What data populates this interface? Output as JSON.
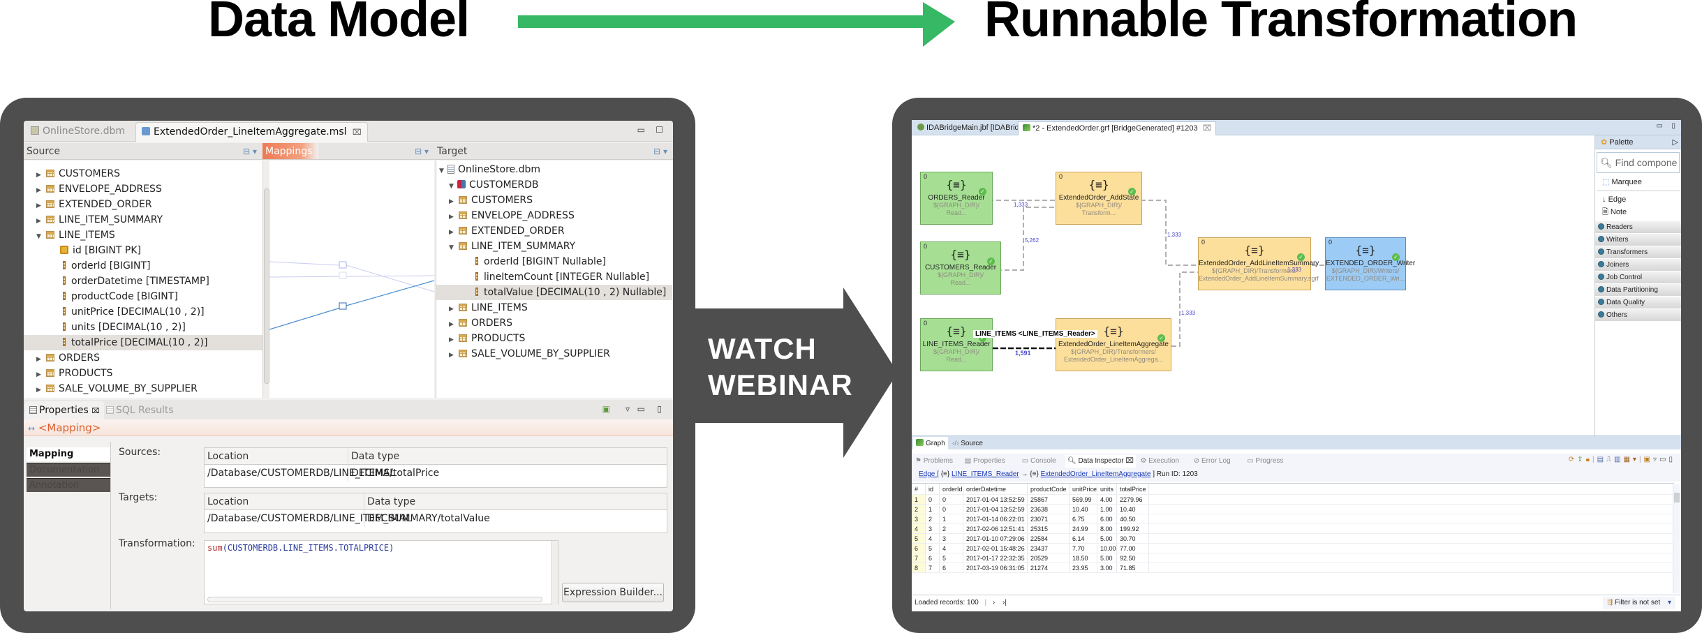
{
  "headline": {
    "left": "Data Model",
    "right": "Runnable Transformation",
    "arrow_color": "#36b864"
  },
  "cta": {
    "line1": "WATCH",
    "line2": "WEBINAR",
    "color": "#4e4e4e"
  },
  "data_model": {
    "tabs": [
      {
        "label": "OnlineStore.dbm",
        "active": false
      },
      {
        "label": "ExtendedOrder_LineItemAggregate.msl",
        "active": true,
        "close": "⌧"
      }
    ],
    "source_header": "Source",
    "mappings_header": "Mappings",
    "target_header": "Target",
    "source_tree": [
      {
        "label": "CUSTOMERS",
        "kind": "table",
        "expanded": false
      },
      {
        "label": "ENVELOPE_ADDRESS",
        "kind": "table",
        "expanded": false
      },
      {
        "label": "EXTENDED_ORDER",
        "kind": "table",
        "expanded": false
      },
      {
        "label": "LINE_ITEM_SUMMARY",
        "kind": "table",
        "expanded": false
      },
      {
        "label": "LINE_ITEMS",
        "kind": "table",
        "expanded": true
      },
      {
        "label": "id [BIGINT PK]",
        "kind": "pk"
      },
      {
        "label": "orderId [BIGINT]",
        "kind": "column"
      },
      {
        "label": "orderDatetime [TIMESTAMP]",
        "kind": "column"
      },
      {
        "label": "productCode [BIGINT]",
        "kind": "column"
      },
      {
        "label": "unitPrice [DECIMAL(10 , 2)]",
        "kind": "column"
      },
      {
        "label": "units [DECIMAL(10 , 2)]",
        "kind": "column"
      },
      {
        "label": "totalPrice [DECIMAL(10 , 2)]",
        "kind": "column",
        "selected": true
      },
      {
        "label": "ORDERS",
        "kind": "table",
        "expanded": false
      },
      {
        "label": "PRODUCTS",
        "kind": "table",
        "expanded": false
      },
      {
        "label": "SALE_VOLUME_BY_SUPPLIER",
        "kind": "table",
        "expanded": false
      }
    ],
    "target_tree": [
      {
        "label": "OnlineStore.dbm",
        "kind": "file",
        "expanded": true
      },
      {
        "label": "CUSTOMERDB",
        "kind": "db",
        "expanded": true
      },
      {
        "label": "CUSTOMERS",
        "kind": "table",
        "expanded": false
      },
      {
        "label": "ENVELOPE_ADDRESS",
        "kind": "table",
        "expanded": false
      },
      {
        "label": "EXTENDED_ORDER",
        "kind": "table",
        "expanded": false
      },
      {
        "label": "LINE_ITEM_SUMMARY",
        "kind": "table",
        "expanded": true
      },
      {
        "label": "orderId [BIGINT Nullable]",
        "kind": "column"
      },
      {
        "label": "lineItemCount [INTEGER Nullable]",
        "kind": "column"
      },
      {
        "label": "totalValue [DECIMAL(10 , 2) Nullable]",
        "kind": "column",
        "selected": true
      },
      {
        "label": "LINE_ITEMS",
        "kind": "table",
        "expanded": false
      },
      {
        "label": "ORDERS",
        "kind": "table",
        "expanded": false
      },
      {
        "label": "PRODUCTS",
        "kind": "table",
        "expanded": false
      },
      {
        "label": "SALE_VOLUME_BY_SUPPLIER",
        "kind": "table",
        "expanded": false
      }
    ],
    "properties": {
      "tabs": [
        {
          "label": "Properties",
          "active": true
        },
        {
          "label": "SQL Results",
          "active": false
        }
      ],
      "title": "<Mapping>",
      "side_tabs": [
        "Mapping",
        "Documentation",
        "Annotation"
      ],
      "sources_label": "Sources:",
      "targets_label": "Targets:",
      "transformation_label": "Transformation:",
      "col_location": "Location",
      "col_datatype": "Data type",
      "sources": [
        {
          "location": "/Database/CUSTOMERDB/LINE_ITEMS/totalPrice",
          "type": "DECIMAL"
        }
      ],
      "targets": [
        {
          "location": "/Database/CUSTOMERDB/LINE_ITEM_SUMMARY/totalValue",
          "type": "DECIMAL"
        }
      ],
      "transformation_fn": "sum",
      "transformation_arg": "(CUSTOMERDB.LINE_ITEMS.TOTALPRICE)",
      "expression_builder": "Expression Builder..."
    }
  },
  "transformation": {
    "tabs": [
      {
        "label": "IDABridgeMain.jbf [IDABridge]",
        "active": false
      },
      {
        "label": "*2 - ExtendedOrder.grf [BridgeGenerated] #1203",
        "active": true
      }
    ],
    "nodes": [
      {
        "id": "orders_reader",
        "name": "ORDERS_Reader",
        "sub1": "${GRAPH_DIR}/",
        "sub2": "Read...",
        "color": "green",
        "count": "0"
      },
      {
        "id": "customers_reader",
        "name": "CUSTOMERS_Reader",
        "sub1": "${GRAPH_DIR}/",
        "sub2": "Read...",
        "color": "green",
        "count": "0"
      },
      {
        "id": "line_items_reader",
        "name": "LINE_ITEMS_Reader",
        "sub1": "${GRAPH_DIR}/",
        "sub2": "Read...",
        "color": "green",
        "count": "0"
      },
      {
        "id": "add_state",
        "name": "ExtendedOrder_AddState",
        "sub1": "${GRAPH_DIR}/",
        "sub2": "Transform...",
        "color": "yellow",
        "count": "0"
      },
      {
        "id": "line_item_aggregate",
        "name": "ExtendedOrder_LineItemAggregate",
        "sub1": "${GRAPH_DIR}/Transformers/",
        "sub2": "ExtendedOrder_LineItemAggrega...",
        "color": "yellow",
        "count": ""
      },
      {
        "id": "add_line_item_summary",
        "name": "ExtendedOrder_AddLineItemSummary",
        "sub1": "${GRAPH_DIR}/Transformers/",
        "sub2": "ExtendedOrder_AddLineItemSummary.sgrf",
        "color": "yellow",
        "count": "0"
      },
      {
        "id": "writer",
        "name": "EXTENDED_ORDER_Writer",
        "sub1": "${GRAPH_DIR}/Writers/",
        "sub2": "EXTENDED_ORDER_Wri...",
        "color": "blue",
        "count": "0"
      }
    ],
    "edge_labels": [
      "1,333",
      "5,262",
      "1,333",
      "1,333",
      "1,333",
      "1,591"
    ],
    "edge_tooltip": "LINE_ITEMS <LINE_ITEMS_Reader>",
    "palette": {
      "title": "Palette",
      "search_placeholder": "Find compone",
      "tools": [
        "Marquee",
        "Edge",
        "Note"
      ],
      "categories": [
        "Readers",
        "Writers",
        "Transformers",
        "Joiners",
        "Job Control",
        "Data Partitioning",
        "Data Quality",
        "Others"
      ]
    },
    "editor_tabs": [
      "Graph",
      "Source"
    ],
    "view_tabs": [
      {
        "label": "Problems",
        "active": false
      },
      {
        "label": "Properties",
        "active": false
      },
      {
        "label": "Console",
        "active": false
      },
      {
        "label": "Data Inspector",
        "active": true
      },
      {
        "label": "Execution",
        "active": false
      },
      {
        "label": "Error Log",
        "active": false
      },
      {
        "label": "Progress",
        "active": false
      }
    ],
    "edge_bar": {
      "prefix": "Edge [",
      "from": "LINE_ITEMS_Reader",
      "arrow": "→",
      "to": "ExtendedOrder_LineItemAggregate",
      "suffix": "] Run ID: 1203"
    },
    "inspector": {
      "columns": [
        "#",
        "id",
        "orderId",
        "orderDatetime",
        "productCode",
        "unitPrice",
        "units",
        "totalPrice"
      ],
      "rows": [
        [
          "1",
          "0",
          "0",
          "2017-01-04 13:52:59",
          "25867",
          "569.99",
          "4.00",
          "2279.96"
        ],
        [
          "2",
          "1",
          "0",
          "2017-01-04 13:52:59",
          "23638",
          "10.40",
          "1.00",
          "10.40"
        ],
        [
          "3",
          "2",
          "1",
          "2017-01-14 06:22:01",
          "23071",
          "6.75",
          "6.00",
          "40.50"
        ],
        [
          "4",
          "3",
          "2",
          "2017-02-06 12:51:41",
          "25315",
          "24.99",
          "8.00",
          "199.92"
        ],
        [
          "5",
          "4",
          "3",
          "2017-01-10 07:29:06",
          "22584",
          "6.14",
          "5.00",
          "30.70"
        ],
        [
          "6",
          "5",
          "4",
          "2017-02-01 15:48:26",
          "23437",
          "7.70",
          "10.00",
          "77.00"
        ],
        [
          "7",
          "6",
          "5",
          "2017-01-17 22:32:35",
          "20529",
          "18.50",
          "5.00",
          "92.50"
        ],
        [
          "8",
          "7",
          "6",
          "2017-03-19 06:31:05",
          "21274",
          "23.95",
          "3.00",
          "71.85"
        ]
      ],
      "loaded": "Loaded records: 100",
      "filter": "Filter is not set"
    }
  }
}
